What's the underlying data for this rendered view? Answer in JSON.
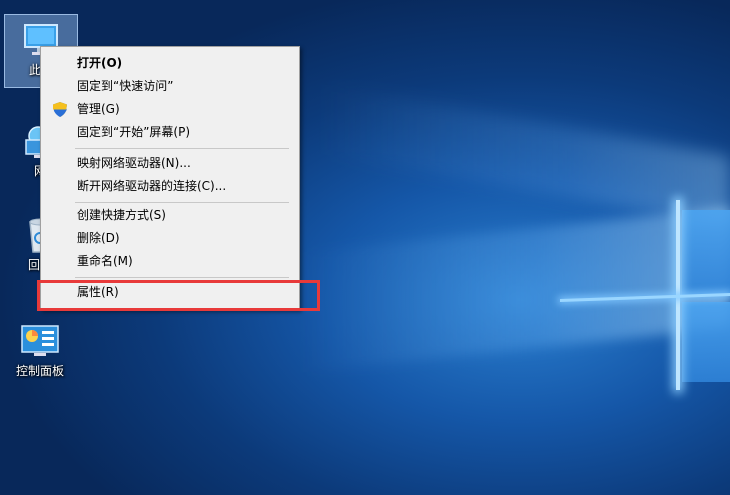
{
  "desktop": {
    "icons": [
      {
        "label": "此电",
        "icon": "computer-icon"
      },
      {
        "label": "网",
        "icon": "network-icon"
      },
      {
        "label": "回收",
        "icon": "recycle-bin-icon"
      },
      {
        "label": "控制面板",
        "icon": "control-panel-icon"
      }
    ]
  },
  "context_menu": {
    "items": [
      {
        "label": "打开(O)",
        "bold": true
      },
      {
        "label": "固定到“快速访问”"
      },
      {
        "label": "管理(G)",
        "icon": "shield-icon"
      },
      {
        "label": "固定到“开始”屏幕(P)"
      },
      {
        "label": "映射网络驱动器(N)..."
      },
      {
        "label": "断开网络驱动器的连接(C)..."
      },
      {
        "label": "创建快捷方式(S)"
      },
      {
        "label": "删除(D)"
      },
      {
        "label": "重命名(M)"
      },
      {
        "label": "属性(R)"
      }
    ]
  },
  "colors": {
    "highlight_border": "#e83a3a",
    "menu_background": "#f0f0f0"
  }
}
